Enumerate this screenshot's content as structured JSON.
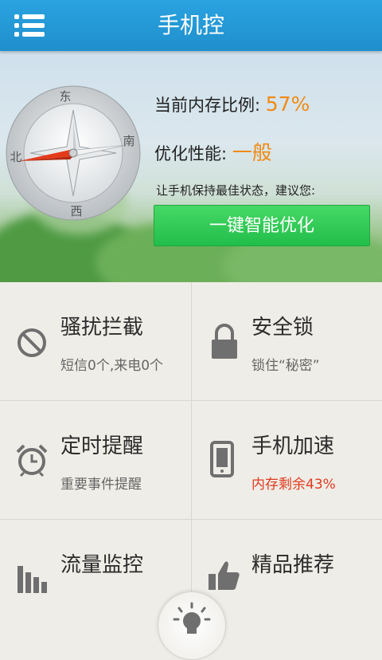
{
  "header": {
    "title": "手机控",
    "menu_icon": "menu-icon"
  },
  "compass": {
    "north": "北",
    "east": "东",
    "south": "南",
    "west": "西"
  },
  "memory": {
    "label": "当前内存比例:",
    "value": "57%",
    "performance_label": "优化性能:",
    "performance_value": "一般",
    "hint": "让手机保持最佳状态，建议您:",
    "optimize_button": "一键智能优化"
  },
  "features": [
    {
      "icon": "block-icon",
      "title": "骚扰拦截",
      "subtitle": "短信0个,来电0个"
    },
    {
      "icon": "lock-icon",
      "title": "安全锁",
      "subtitle": "锁住“秘密”"
    },
    {
      "icon": "alarm-clock-icon",
      "title": "定时提醒",
      "subtitle": "重要事件提醒"
    },
    {
      "icon": "phone-icon",
      "title": "手机加速",
      "subtitle": "内存剩余43%"
    },
    {
      "icon": "bar-chart-icon",
      "title": "流量监控",
      "subtitle": ""
    },
    {
      "icon": "thumbs-up-icon",
      "title": "精品推荐",
      "subtitle": ""
    }
  ],
  "colors": {
    "header": "#1f8fcc",
    "accent_orange": "#f08a12",
    "button_green": "#22be4a",
    "warning_red": "#e23a1e"
  },
  "bottom_button_icon": "lightbulb-icon"
}
